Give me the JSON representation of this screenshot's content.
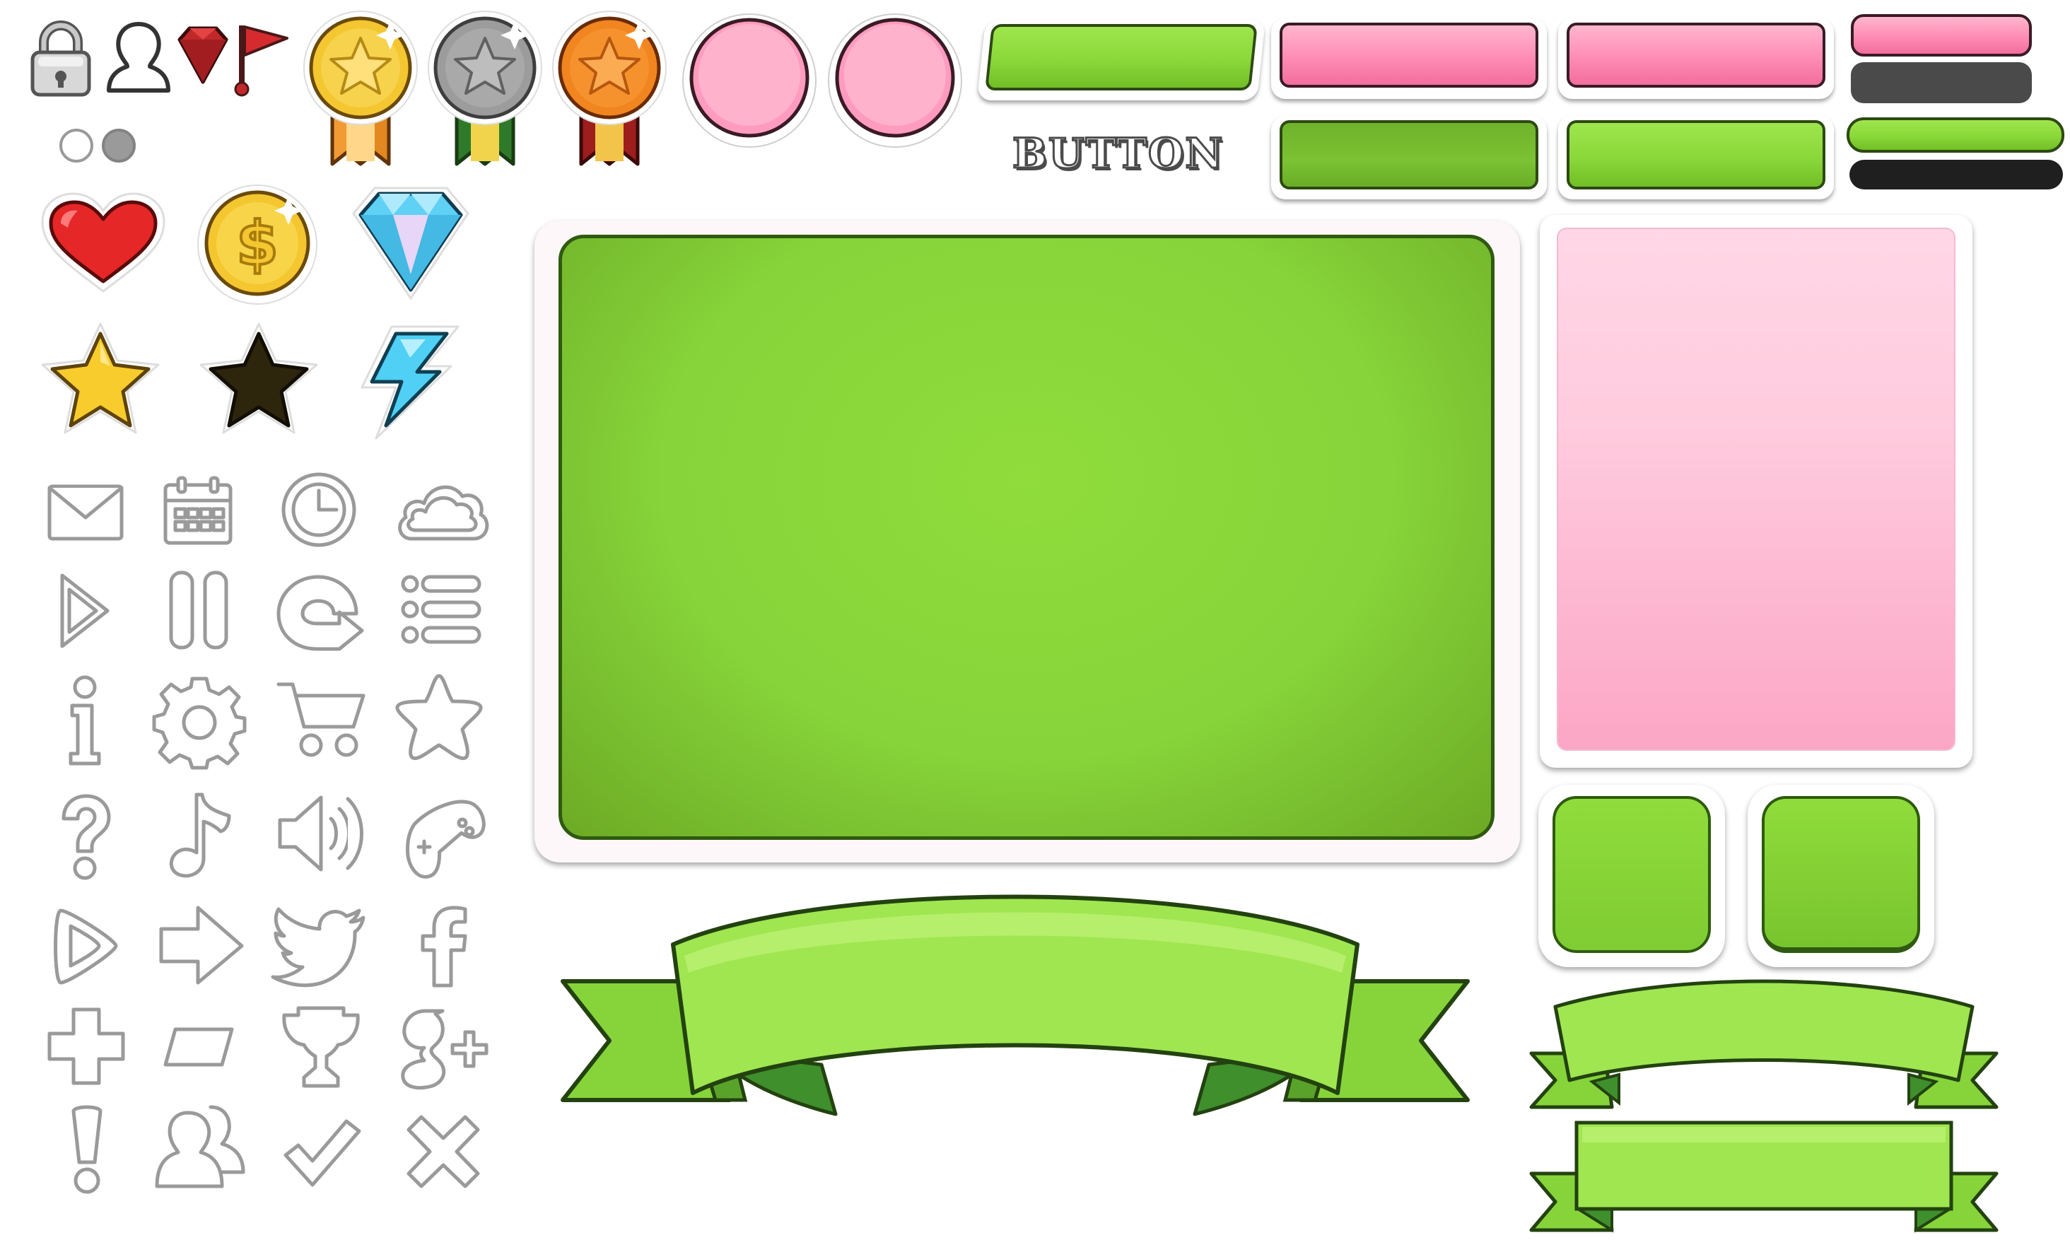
{
  "title_word": "BUTTON",
  "colors": {
    "green": "#86d43a",
    "green_dark_border": "#2f5a10",
    "pink": "#ff93b9",
    "pink_light": "#ffd7e6",
    "gold": "#f4c630",
    "silver": "#9c9c9c",
    "bronze": "#f1851f",
    "heart_red": "#e52727",
    "diamond_blue": "#5fd1f5",
    "bolt_blue": "#4fd0f4",
    "icon_outline": "#9a9a9a"
  },
  "top_icons": [
    "lock-icon",
    "profile-silhouette-icon",
    "gem-icon",
    "flag-icon"
  ],
  "toggle_dots": [
    "toggle-off-dot",
    "toggle-on-dot"
  ],
  "medals": [
    "gold-medal",
    "silver-medal",
    "bronze-medal"
  ],
  "collectibles": [
    "heart-icon",
    "coin-icon",
    "diamond-icon",
    "star-gold-icon",
    "star-dark-icon",
    "lightning-icon"
  ],
  "outline_icons": [
    "mail-icon",
    "calendar-icon",
    "clock-icon",
    "cloud-icon",
    "play-icon",
    "pause-icon",
    "restart-icon",
    "list-icon",
    "info-icon",
    "gear-icon",
    "cart-icon",
    "star-outline-icon",
    "help-icon",
    "music-icon",
    "sound-icon",
    "gamepad-icon",
    "next-icon",
    "arrow-right-icon",
    "twitter-icon",
    "facebook-icon",
    "plus-icon",
    "blank-tag-icon",
    "trophy-icon",
    "google-plus-icon",
    "exclamation-icon",
    "users-icon",
    "check-icon",
    "close-icon"
  ]
}
